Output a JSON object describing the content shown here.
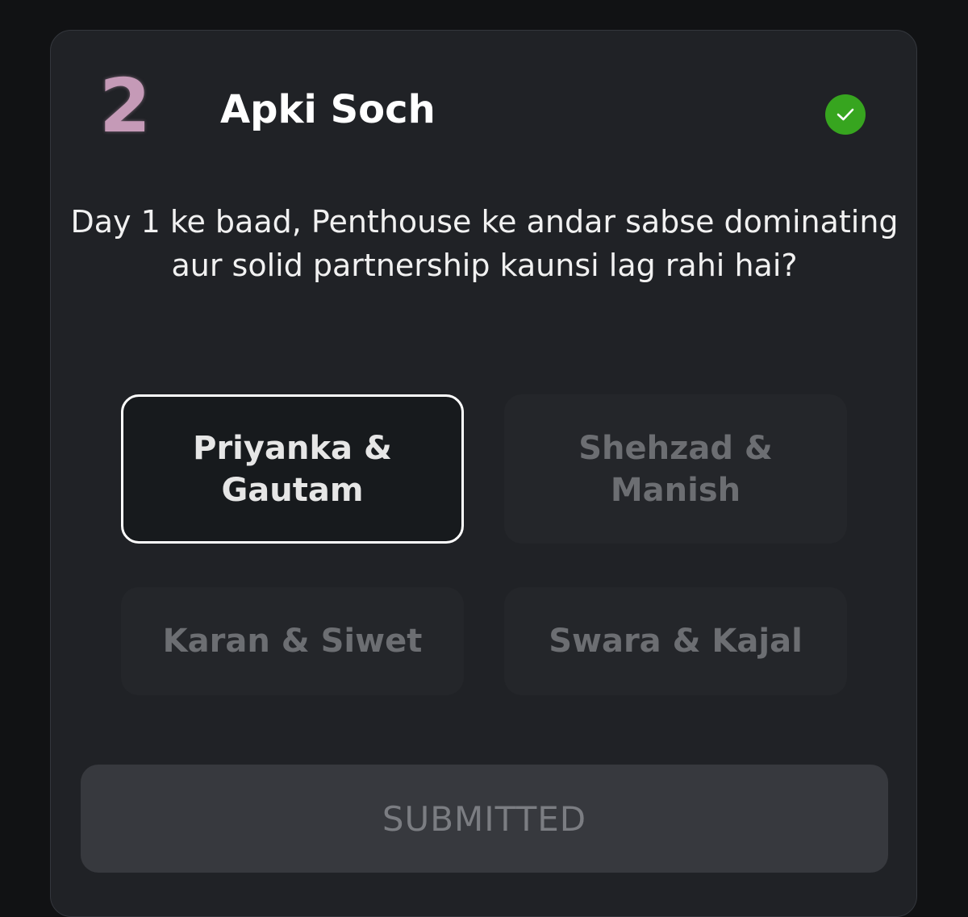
{
  "question": {
    "number": "2",
    "title": "Apki Soch",
    "text": "Day 1 ke baad, Penthouse ke andar sabse dominating aur solid partnership kaunsi lag rahi hai?",
    "status_icon": "check-circle-icon"
  },
  "options": [
    {
      "label": "Priyanka & Gautam",
      "selected": true
    },
    {
      "label": "Shehzad & Manish",
      "selected": false
    },
    {
      "label": "Karan & Siwet",
      "selected": false
    },
    {
      "label": "Swara & Kajal",
      "selected": false
    }
  ],
  "submit": {
    "label": "SUBMITTED"
  },
  "colors": {
    "background": "#111214",
    "card": "#202226",
    "accent_number": "#c59ab7",
    "success": "#37a51f"
  }
}
